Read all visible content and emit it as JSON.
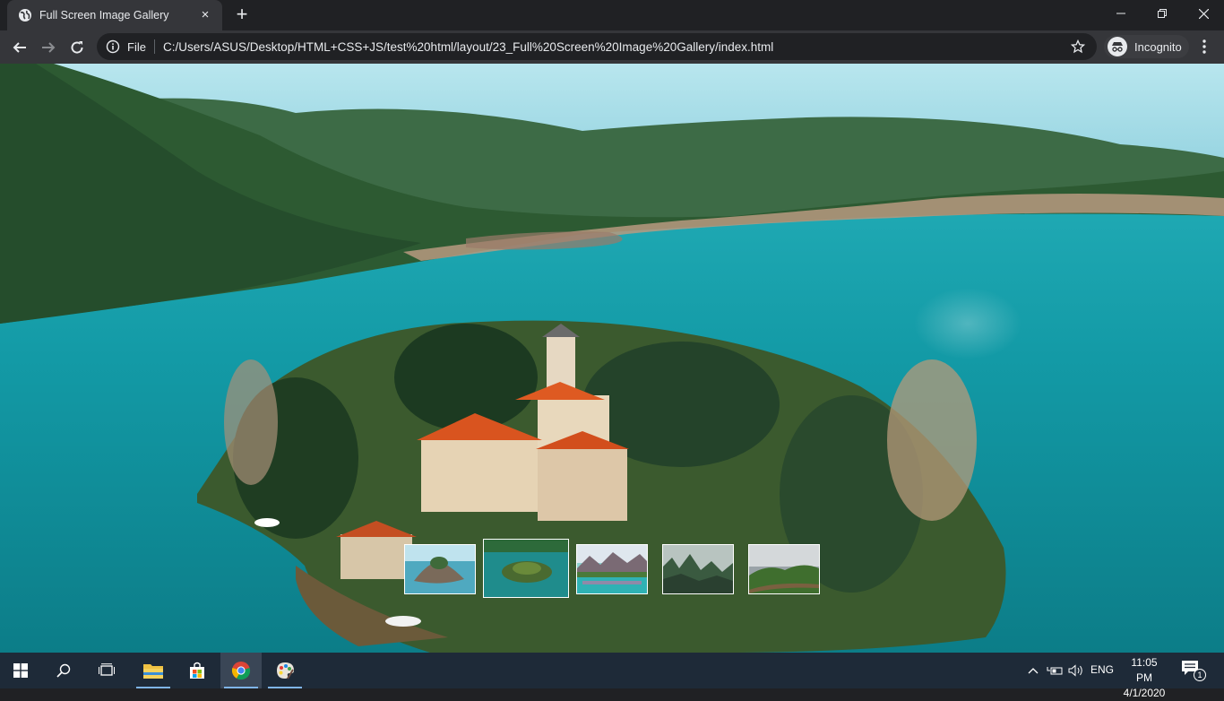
{
  "browser": {
    "tab": {
      "title": "Full Screen Image Gallery",
      "close_glyph": "×",
      "favicon": "globe-icon"
    },
    "new_tab_glyph": "+",
    "address": {
      "scheme_label": "File",
      "url": "C:/Users/ASUS/Desktop/HTML+CSS+JS/test%20html/layout/23_Full%20Screen%20Image%20Gallery/index.html"
    },
    "profile_label": "Incognito",
    "colors": {
      "frame": "#202124",
      "toolbar": "#35363a",
      "text": "#e8eaed"
    }
  },
  "gallery": {
    "main_image": "aerial-lake-island-monastery",
    "thumbnails": [
      {
        "name": "rock-island",
        "selected": false
      },
      {
        "name": "green-lake-island",
        "selected": true
      },
      {
        "name": "mountain-lake-reflection",
        "selected": false
      },
      {
        "name": "misty-forest",
        "selected": false
      },
      {
        "name": "cloudy-valley-road",
        "selected": false
      }
    ],
    "colors": {
      "lake": "#1ea8b0",
      "hills": "#2f5e2f",
      "sky": "#9fd8e6",
      "thumb_border": "#ffffff"
    }
  },
  "taskbar": {
    "apps": [
      "start-icon",
      "search-icon",
      "task-view-icon",
      "file-explorer-icon",
      "store-icon",
      "chrome-icon",
      "paint-icon"
    ],
    "active_app": "chrome-icon",
    "language": "ENG",
    "time": "11:05 PM",
    "date": "4/1/2020",
    "notification_count": "1",
    "colors": {
      "background": "#1e2a38",
      "accent": "#7fb4e8"
    }
  }
}
